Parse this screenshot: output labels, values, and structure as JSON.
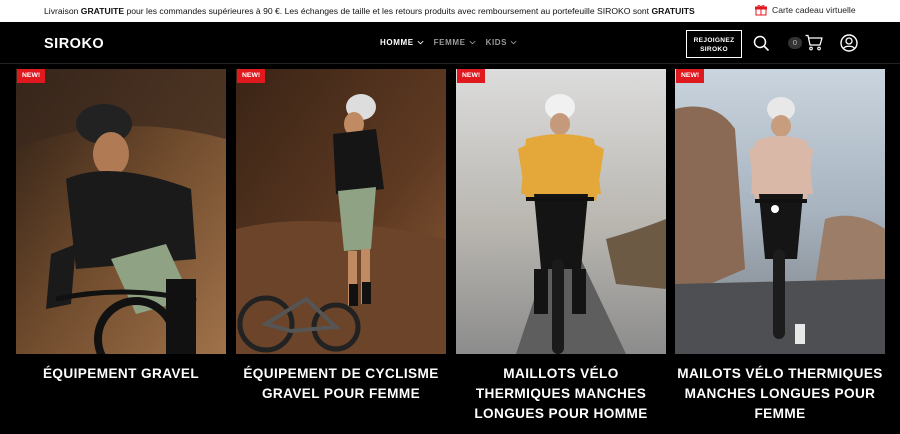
{
  "topbar": {
    "message_part1": "Livraison ",
    "message_bold1": "GRATUITE",
    "message_part2": " pour les commandes supérieures à 90 €. Les échanges de taille et les retours produits avec remboursement au portefeuille SIROKO sont ",
    "message_bold2": "GRATUITS",
    "gift_card_label": "Carte cadeau virtuelle",
    "gift_icon": "gift-icon"
  },
  "header": {
    "logo": "SIROKO",
    "nav": [
      {
        "label": "HOMME",
        "active": true
      },
      {
        "label": "FEMME",
        "active": false
      },
      {
        "label": "KIDS",
        "active": false
      }
    ],
    "join_label_line1": "REJOIGNEZ",
    "join_label_line2": "SIROKO",
    "cart_count": "0",
    "icons": [
      "search-icon",
      "cart-icon",
      "account-icon"
    ]
  },
  "products": [
    {
      "badge": "NEW!",
      "title": "ÉQUIPEMENT GRAVEL"
    },
    {
      "badge": "NEW!",
      "title": "ÉQUIPEMENT DE CYCLISME GRAVEL POUR FEMME"
    },
    {
      "badge": "NEW!",
      "title": "MAILLOTS VÉLO THERMIQUES MANCHES LONGUES POUR HOMME"
    },
    {
      "badge": "NEW!",
      "title": "MAILOTS VÉLO THERMIQUES MANCHES LONGUES POUR FEMME"
    }
  ],
  "colors": {
    "badge_red": "#e0191f",
    "header_bg": "#000000",
    "topbar_bg": "#ffffff"
  }
}
